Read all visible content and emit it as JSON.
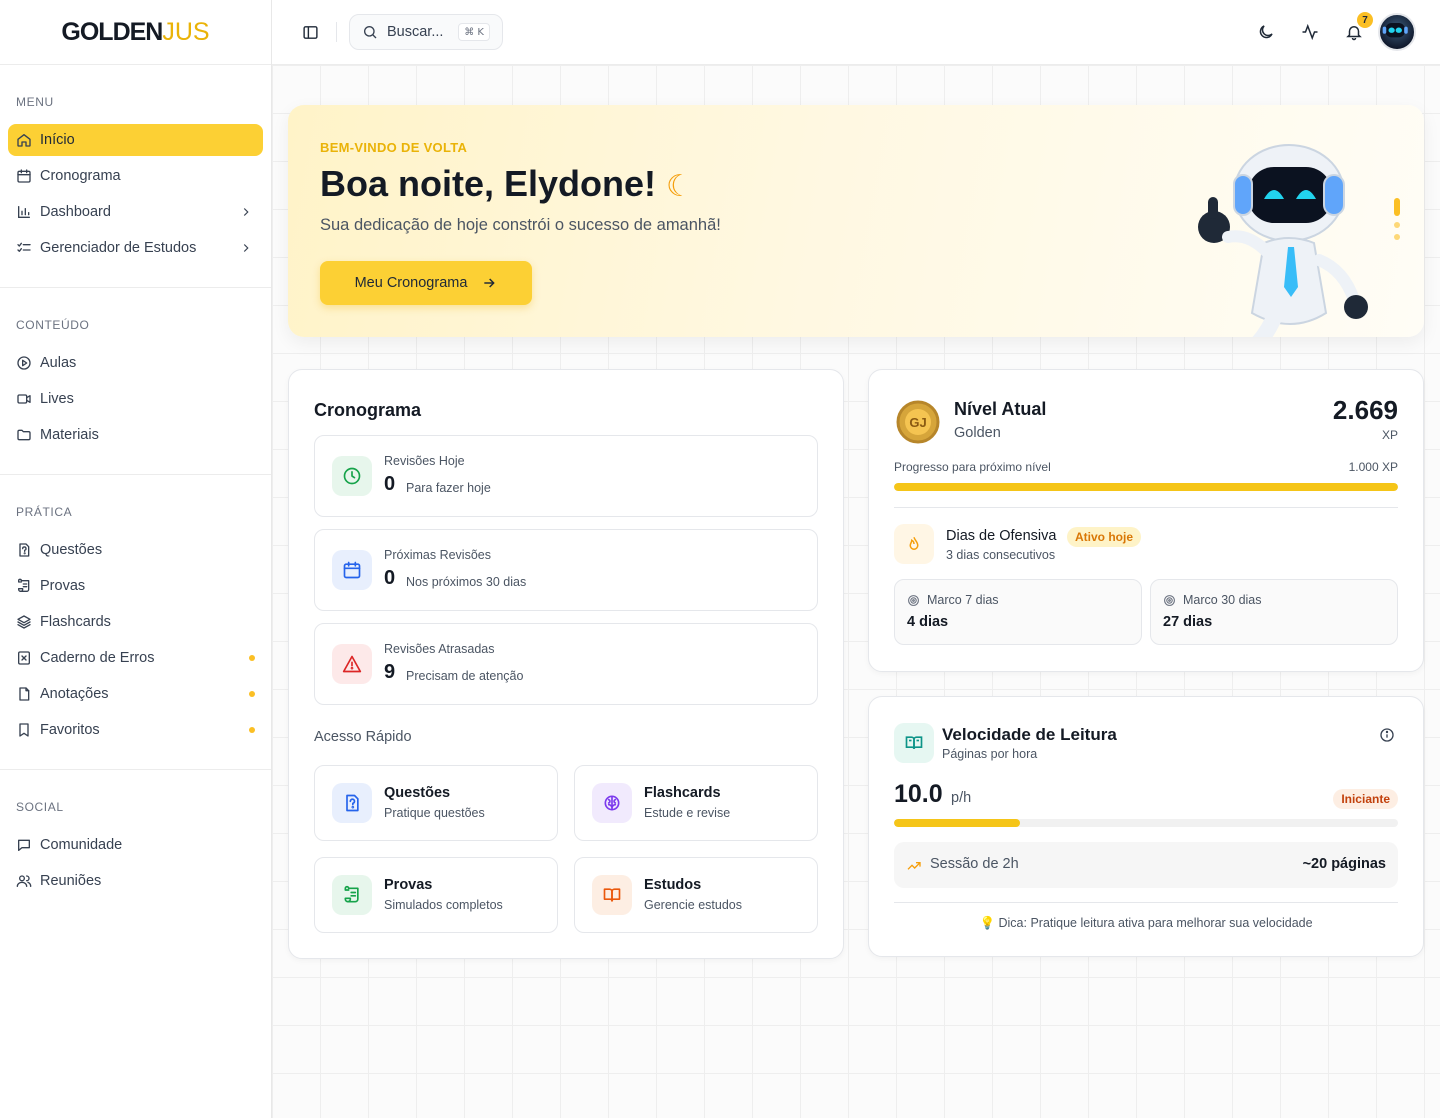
{
  "brand": {
    "logo_main": "GOLDEN",
    "logo_accent": "JUS"
  },
  "sidebar": {
    "sections": [
      {
        "heading": "MENU",
        "items": [
          {
            "label": "Início",
            "icon": "home-icon",
            "active": true
          },
          {
            "label": "Cronograma",
            "icon": "calendar-icon"
          },
          {
            "label": "Dashboard",
            "icon": "bar-chart-icon",
            "chevron": true
          },
          {
            "label": "Gerenciador de Estudos",
            "icon": "list-check-icon",
            "chevron": true
          }
        ]
      },
      {
        "heading": "CONTEÚDO",
        "items": [
          {
            "label": "Aulas",
            "icon": "play-circle-icon"
          },
          {
            "label": "Lives",
            "icon": "video-icon"
          },
          {
            "label": "Materiais",
            "icon": "folder-icon"
          }
        ]
      },
      {
        "heading": "PRÁTICA",
        "items": [
          {
            "label": "Questões",
            "icon": "question-file-icon"
          },
          {
            "label": "Provas",
            "icon": "scroll-icon"
          },
          {
            "label": "Flashcards",
            "icon": "layers-icon"
          },
          {
            "label": "Caderno de Erros",
            "icon": "x-square-icon",
            "dot": true
          },
          {
            "label": "Anotações",
            "icon": "file-icon",
            "dot": true
          },
          {
            "label": "Favoritos",
            "icon": "bookmark-icon",
            "dot": true
          }
        ]
      },
      {
        "heading": "SOCIAL",
        "items": [
          {
            "label": "Comunidade",
            "icon": "chat-icon"
          },
          {
            "label": "Reuniões",
            "icon": "users-icon"
          }
        ]
      }
    ]
  },
  "topbar": {
    "search_placeholder": "Buscar...",
    "search_shortcut": "⌘ K",
    "notification_count": "7"
  },
  "hero": {
    "kicker": "BEM-VINDO DE VOLTA",
    "title": "Boa noite, Elydone!",
    "emoji": "☾",
    "subtitle": "Sua dedicação de hoje constrói o sucesso de amanhã!",
    "button_label": "Meu Cronograma"
  },
  "cronograma": {
    "title": "Cronograma",
    "reviews": [
      {
        "label": "Revisões Hoje",
        "value": "0",
        "desc": "Para fazer hoje",
        "icon": "clock-icon",
        "tone": "#16a34a",
        "bg": "#e7f6ec"
      },
      {
        "label": "Próximas Revisões",
        "value": "0",
        "desc": "Nos próximos 30 dias",
        "icon": "calendar-icon",
        "tone": "#2563eb",
        "bg": "#e8effd"
      },
      {
        "label": "Revisões Atrasadas",
        "value": "9",
        "desc": "Precisam de atenção",
        "icon": "alert-triangle-icon",
        "tone": "#dc2626",
        "bg": "#fde9e9"
      }
    ],
    "quick_access_label": "Acesso Rápido",
    "quick_access": [
      {
        "title": "Questões",
        "subtitle": "Pratique questões",
        "icon": "question-file-icon",
        "tone": "#2563eb",
        "bg": "#e8effd"
      },
      {
        "title": "Flashcards",
        "subtitle": "Estude e revise",
        "icon": "brain-icon",
        "tone": "#7c3aed",
        "bg": "#f1eafd"
      },
      {
        "title": "Provas",
        "subtitle": "Simulados completos",
        "icon": "scroll-icon",
        "tone": "#16a34a",
        "bg": "#e7f6ec"
      },
      {
        "title": "Estudos",
        "subtitle": "Gerencie estudos",
        "icon": "book-open-icon",
        "tone": "#ea580c",
        "bg": "#fdeee3"
      }
    ]
  },
  "level": {
    "title": "Nível Atual",
    "tier": "Golden",
    "xp_value": "2.669",
    "xp_unit": "XP",
    "progress_label": "Progresso para próximo nível",
    "progress_target": "1.000 XP",
    "progress_fraction": 1.0,
    "streak_title": "Dias de Ofensiva",
    "streak_badge": "Ativo hoje",
    "streak_sub": "3 dias consecutivos",
    "milestones": [
      {
        "label": "Marco 7 dias",
        "value": "4 dias"
      },
      {
        "label": "Marco 30 dias",
        "value": "27 dias"
      }
    ]
  },
  "reading": {
    "title": "Velocidade de Leitura",
    "subtitle": "Páginas por hora",
    "value": "10.0",
    "unit": "p/h",
    "level_badge": "Iniciante",
    "progress_fraction": 0.25,
    "session_label": "Sessão de 2h",
    "session_value": "~20 páginas",
    "tip": "Dica: Pratique leitura ativa para melhorar sua velocidade"
  },
  "colors": {
    "accent": "#fcd034",
    "accent_dark": "#eab308"
  }
}
